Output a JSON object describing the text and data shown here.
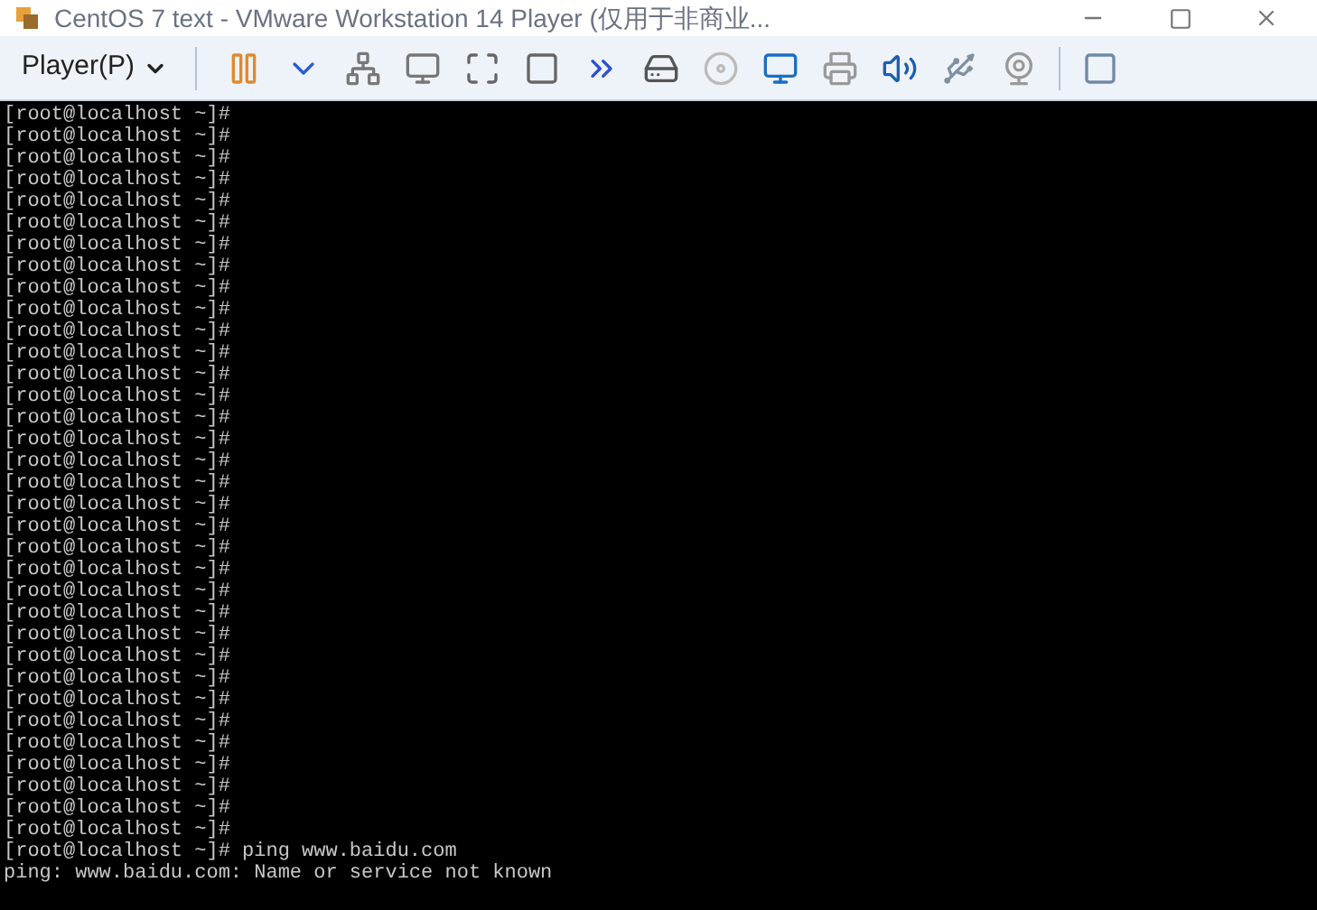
{
  "window": {
    "title": "CentOS 7 text - VMware Workstation 14 Player (仅用于非商业..."
  },
  "toolbar": {
    "menu_label": "Player(P)"
  },
  "terminal": {
    "lines": [
      "[root@localhost ~]#",
      "[root@localhost ~]#",
      "[root@localhost ~]#",
      "[root@localhost ~]#",
      "[root@localhost ~]#",
      "[root@localhost ~]#",
      "[root@localhost ~]#",
      "[root@localhost ~]#",
      "[root@localhost ~]#",
      "[root@localhost ~]#",
      "[root@localhost ~]#",
      "[root@localhost ~]#",
      "[root@localhost ~]#",
      "[root@localhost ~]#",
      "[root@localhost ~]#",
      "[root@localhost ~]#",
      "[root@localhost ~]#",
      "[root@localhost ~]#",
      "[root@localhost ~]#",
      "[root@localhost ~]#",
      "[root@localhost ~]#",
      "[root@localhost ~]#",
      "[root@localhost ~]#",
      "[root@localhost ~]#",
      "[root@localhost ~]#",
      "[root@localhost ~]#",
      "[root@localhost ~]#",
      "[root@localhost ~]#",
      "[root@localhost ~]#",
      "[root@localhost ~]#",
      "[root@localhost ~]#",
      "[root@localhost ~]#",
      "[root@localhost ~]#",
      "[root@localhost ~]#",
      "[root@localhost ~]# ping www.baidu.com",
      "ping: www.baidu.com: Name or service not known"
    ]
  }
}
